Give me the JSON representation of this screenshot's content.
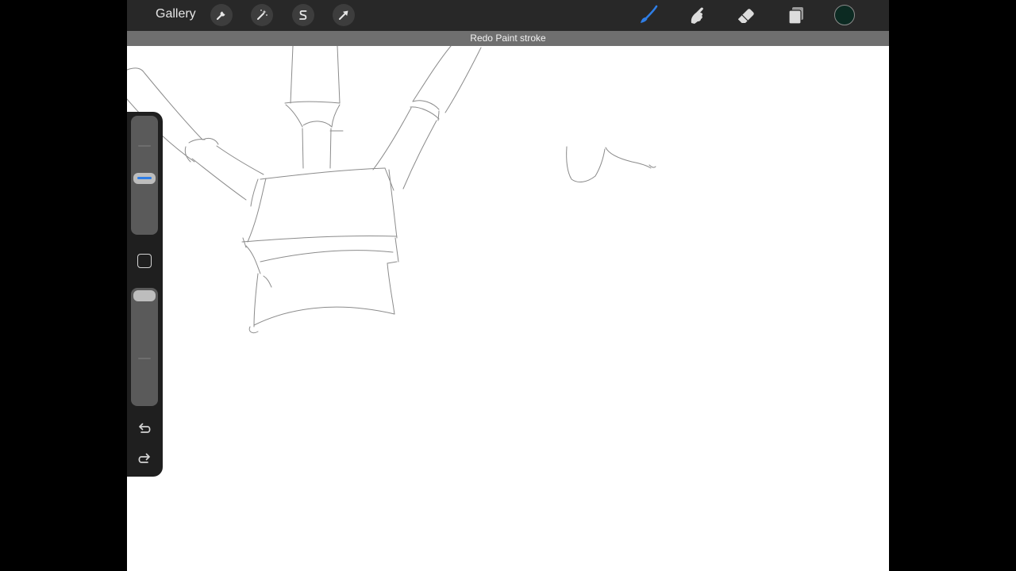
{
  "topbar": {
    "gallery_label": "Gallery",
    "left_tools": [
      {
        "name": "actions",
        "icon": "wrench-icon"
      },
      {
        "name": "adjustments",
        "icon": "magic-wand-icon"
      },
      {
        "name": "selection",
        "icon": "selection-s-icon"
      },
      {
        "name": "transform",
        "icon": "arrow-cursor-icon"
      }
    ],
    "right_tools": [
      {
        "name": "brush",
        "icon": "brush-icon",
        "active": true
      },
      {
        "name": "smudge",
        "icon": "smudge-finger-icon",
        "active": false
      },
      {
        "name": "eraser",
        "icon": "eraser-icon",
        "active": false
      },
      {
        "name": "layers",
        "icon": "layers-icon",
        "active": false
      }
    ],
    "current_color": "#0c2a22",
    "active_tool_color": "#2f7ee6"
  },
  "notice": {
    "text": "Redo Paint stroke"
  },
  "sidebar": {
    "brush_size_level": 0.47,
    "opacity_level": 1.0,
    "modify_button_icon": "square-icon",
    "undo_icon": "undo-arrow-icon",
    "redo_icon": "redo-arrow-icon"
  },
  "colors": {
    "app_bar": "#282828",
    "notice_bar": "#6f6f6f",
    "canvas": "#ffffff",
    "sidebar": "#1f1f1f",
    "sketch_stroke": "#6b6b6b"
  }
}
